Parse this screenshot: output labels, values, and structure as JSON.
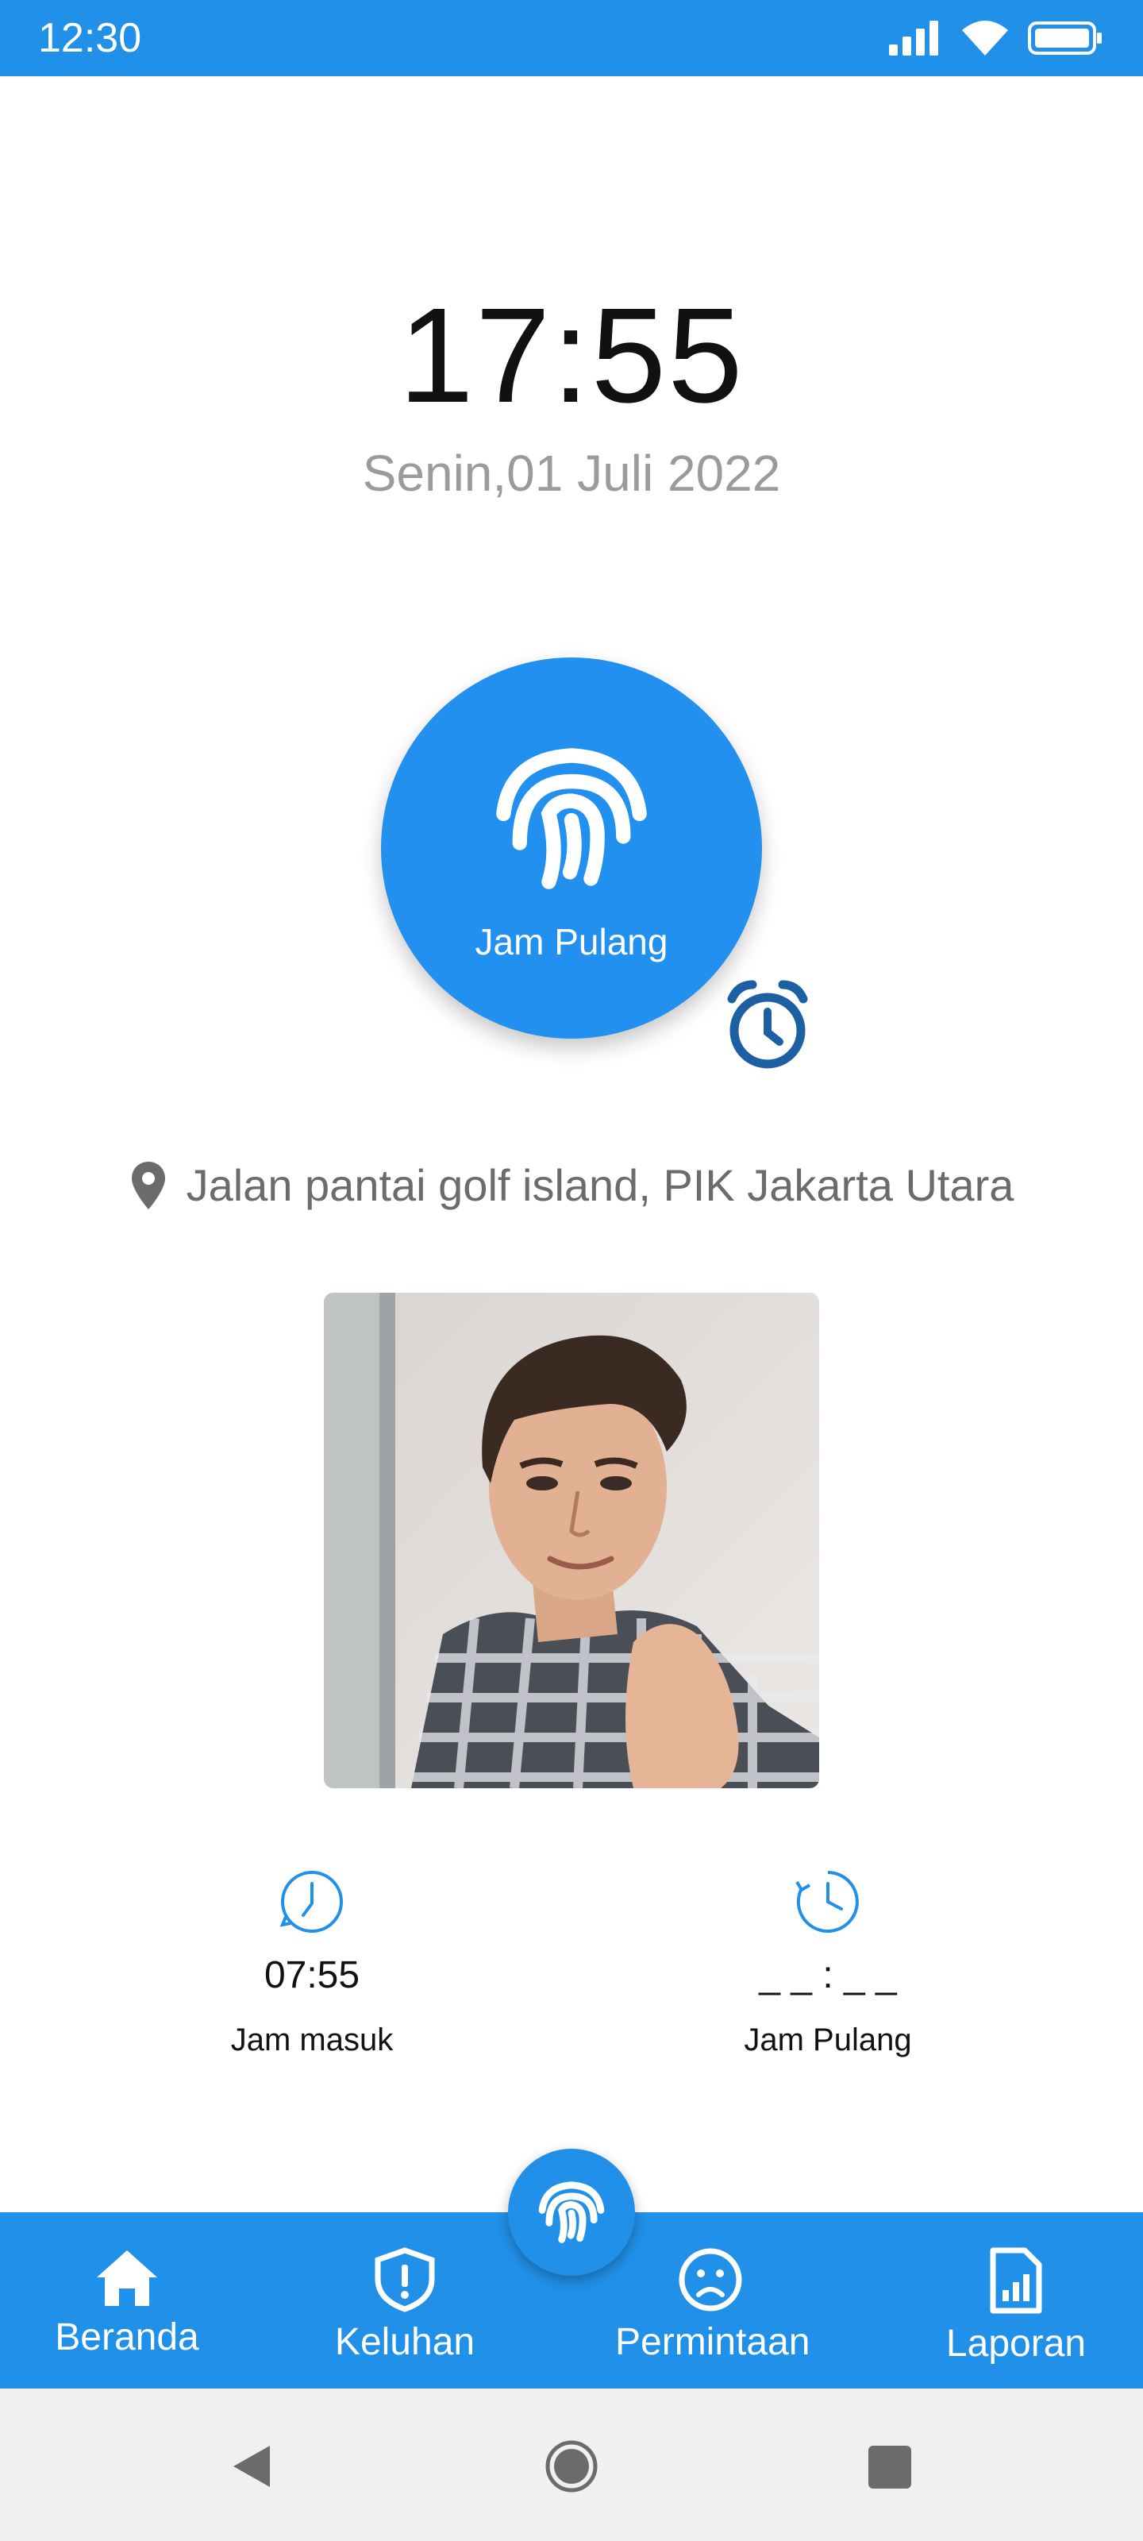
{
  "status_bar": {
    "time": "12:30",
    "icons": [
      "signal-icon",
      "wifi-icon",
      "battery-icon"
    ]
  },
  "clock": {
    "time": "17:55",
    "date": "Senin,01 Juli 2022"
  },
  "main_button": {
    "label": "Jam Pulang",
    "icon": "fingerprint-icon"
  },
  "location": {
    "icon": "location-pin-icon",
    "text": "Jalan pantai golf island, PIK Jakarta Utara"
  },
  "times": {
    "in": {
      "value": "07:55",
      "label": "Jam masuk",
      "icon": "clock-icon"
    },
    "out": {
      "value": "_ _ : _ _",
      "label": "Jam Pulang",
      "icon": "clock-history-icon"
    }
  },
  "bottom_nav": {
    "items": [
      {
        "label": "Beranda",
        "icon": "home-icon"
      },
      {
        "label": "Keluhan",
        "icon": "shield-alert-icon"
      },
      {
        "label": "Permintaan",
        "icon": "sad-face-icon"
      },
      {
        "label": "Laporan",
        "icon": "report-icon"
      }
    ],
    "center_icon": "fingerprint-icon"
  },
  "colors": {
    "primary": "#2190e8",
    "dark_icon": "#1c5fa3",
    "muted_text": "#9b9b9b"
  }
}
